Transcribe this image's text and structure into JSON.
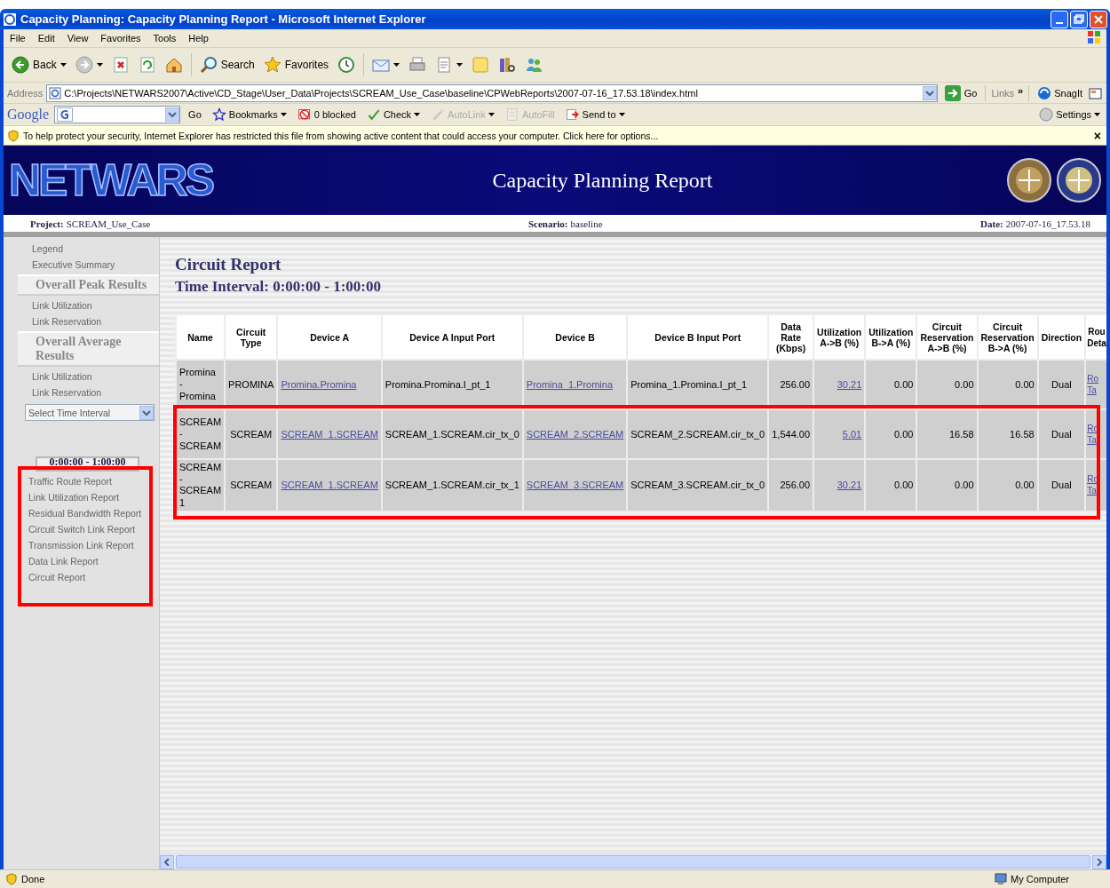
{
  "window": {
    "title": "Capacity Planning: Capacity Planning Report - Microsoft Internet Explorer"
  },
  "menu": [
    "File",
    "Edit",
    "View",
    "Favorites",
    "Tools",
    "Help"
  ],
  "toolbar": [
    {
      "kind": "back",
      "label": "Back"
    },
    {
      "kind": "forward"
    },
    {
      "kind": "stop"
    },
    {
      "kind": "refresh"
    },
    {
      "kind": "home"
    },
    {
      "kind": "search",
      "label": "Search"
    },
    {
      "kind": "favorites",
      "label": "Favorites"
    },
    {
      "kind": "history"
    },
    {
      "kind": "mail"
    },
    {
      "kind": "print"
    },
    {
      "kind": "edit"
    },
    {
      "kind": "note"
    },
    {
      "kind": "research"
    },
    {
      "kind": "messenger"
    }
  ],
  "address": {
    "label": "Address",
    "value": "C:\\Projects\\NETWARS2007\\Active\\CD_Stage\\User_Data\\Projects\\SCREAM_Use_Case\\baseline\\CPWebReports\\2007-07-16_17.53.18\\index.html",
    "go": "Go",
    "links": "Links",
    "links_more": "»",
    "snagit": "SnagIt"
  },
  "google_bar": {
    "logo": "Google",
    "items": [
      {
        "kind": "go",
        "label": "Go",
        "disabled": false
      },
      {
        "kind": "bookmarks",
        "label": "Bookmarks",
        "disabled": false
      },
      {
        "kind": "blocked",
        "label": "0 blocked",
        "disabled": false
      },
      {
        "kind": "check",
        "label": "Check",
        "disabled": false
      },
      {
        "kind": "autolink",
        "label": "AutoLink",
        "disabled": true
      },
      {
        "kind": "autofill",
        "label": "AutoFill",
        "disabled": true
      },
      {
        "kind": "sendto",
        "label": "Send to",
        "disabled": false
      }
    ],
    "settings": "Settings"
  },
  "info_bar": {
    "text": "To help protect your security, Internet Explorer has restricted this file from showing active content that could access your computer. Click here for options...",
    "close": "×"
  },
  "banner": {
    "logo": "NETWARS",
    "title": "Capacity Planning Report"
  },
  "sub_bar": {
    "project_label": "Project:",
    "project": "SCREAM_Use_Case",
    "scenario_label": "Scenario:",
    "scenario": "baseline",
    "date_label": "Date:",
    "date": "2007-07-16_17.53.18"
  },
  "sidebar": [
    {
      "kind": "link",
      "label": "Legend"
    },
    {
      "kind": "link",
      "label": "Executive Summary"
    },
    {
      "kind": "heading",
      "label": "Overall Peak Results"
    },
    {
      "kind": "link",
      "label": "Link Utilization"
    },
    {
      "kind": "link",
      "label": "Link Reservation"
    },
    {
      "kind": "heading",
      "label": "Overall Average Results"
    },
    {
      "kind": "link",
      "label": "Link Utilization"
    },
    {
      "kind": "link",
      "label": "Link Reservation"
    },
    {
      "kind": "select",
      "label": "Select Time Interval"
    },
    {
      "kind": "interval",
      "label": "0:00:00 - 1:00:00"
    },
    {
      "kind": "link",
      "label": "Traffic Route Report"
    },
    {
      "kind": "link",
      "label": "Link Utilization Report"
    },
    {
      "kind": "link",
      "label": "Residual Bandwidth Report"
    },
    {
      "kind": "link",
      "label": "Circuit Switch Link Report"
    },
    {
      "kind": "link",
      "label": "Transmission Link Report"
    },
    {
      "kind": "link",
      "label": "Data Link Report"
    },
    {
      "kind": "link",
      "label": "Circuit Report"
    }
  ],
  "report": {
    "title": "Circuit Report",
    "subtitle": "Time Interval: 0:00:00 - 1:00:00",
    "columns": [
      "Name",
      "Circuit Type",
      "Device A",
      "Device A Input Port",
      "Device B",
      "Device B Input Port",
      "Data Rate (Kbps)",
      "Utilization A->B (%)",
      "Utilization B->A (%)",
      "Circuit Reservation A->B (%)",
      "Circuit Reservation B->A (%)",
      "Direction",
      "Rou Deta"
    ],
    "rows": [
      [
        "Promina - Promina",
        "PROMINA",
        {
          "text": "Promina.Promina",
          "link": true
        },
        "Promina.Promina.I_pt_1",
        {
          "text": "Promina_1.Promina",
          "link": true
        },
        "Promina_1.Promina.I_pt_1",
        "256.00",
        {
          "text": "30.21",
          "link": true
        },
        "0.00",
        "0.00",
        "0.00",
        "Dual",
        {
          "text": "Ro Ta",
          "link": true
        }
      ],
      [
        "SCREAM - SCREAM",
        "SCREAM",
        {
          "text": "SCREAM_1.SCREAM",
          "link": true
        },
        "SCREAM_1.SCREAM.cir_tx_0",
        {
          "text": "SCREAM_2.SCREAM",
          "link": true
        },
        "SCREAM_2.SCREAM.cir_tx_0",
        "1,544.00",
        {
          "text": "5.01",
          "link": true
        },
        "0.00",
        "16.58",
        "16.58",
        "Dual",
        {
          "text": "Ro Ta",
          "link": true
        }
      ],
      [
        "SCREAM - SCREAM 1",
        "SCREAM",
        {
          "text": "SCREAM_1.SCREAM",
          "link": true
        },
        "SCREAM_1.SCREAM.cir_tx_1",
        {
          "text": "SCREAM_3.SCREAM",
          "link": true
        },
        "SCREAM_3.SCREAM.cir_tx_0",
        "256.00",
        {
          "text": "30.21",
          "link": true
        },
        "0.00",
        "0.00",
        "0.00",
        "Dual",
        {
          "text": "Ro Ta",
          "link": true
        }
      ]
    ]
  },
  "annotations": [
    {
      "kind": "box"
    },
    {
      "kind": "box"
    }
  ],
  "status_bar": {
    "text": "Done",
    "zone": "My Computer"
  }
}
